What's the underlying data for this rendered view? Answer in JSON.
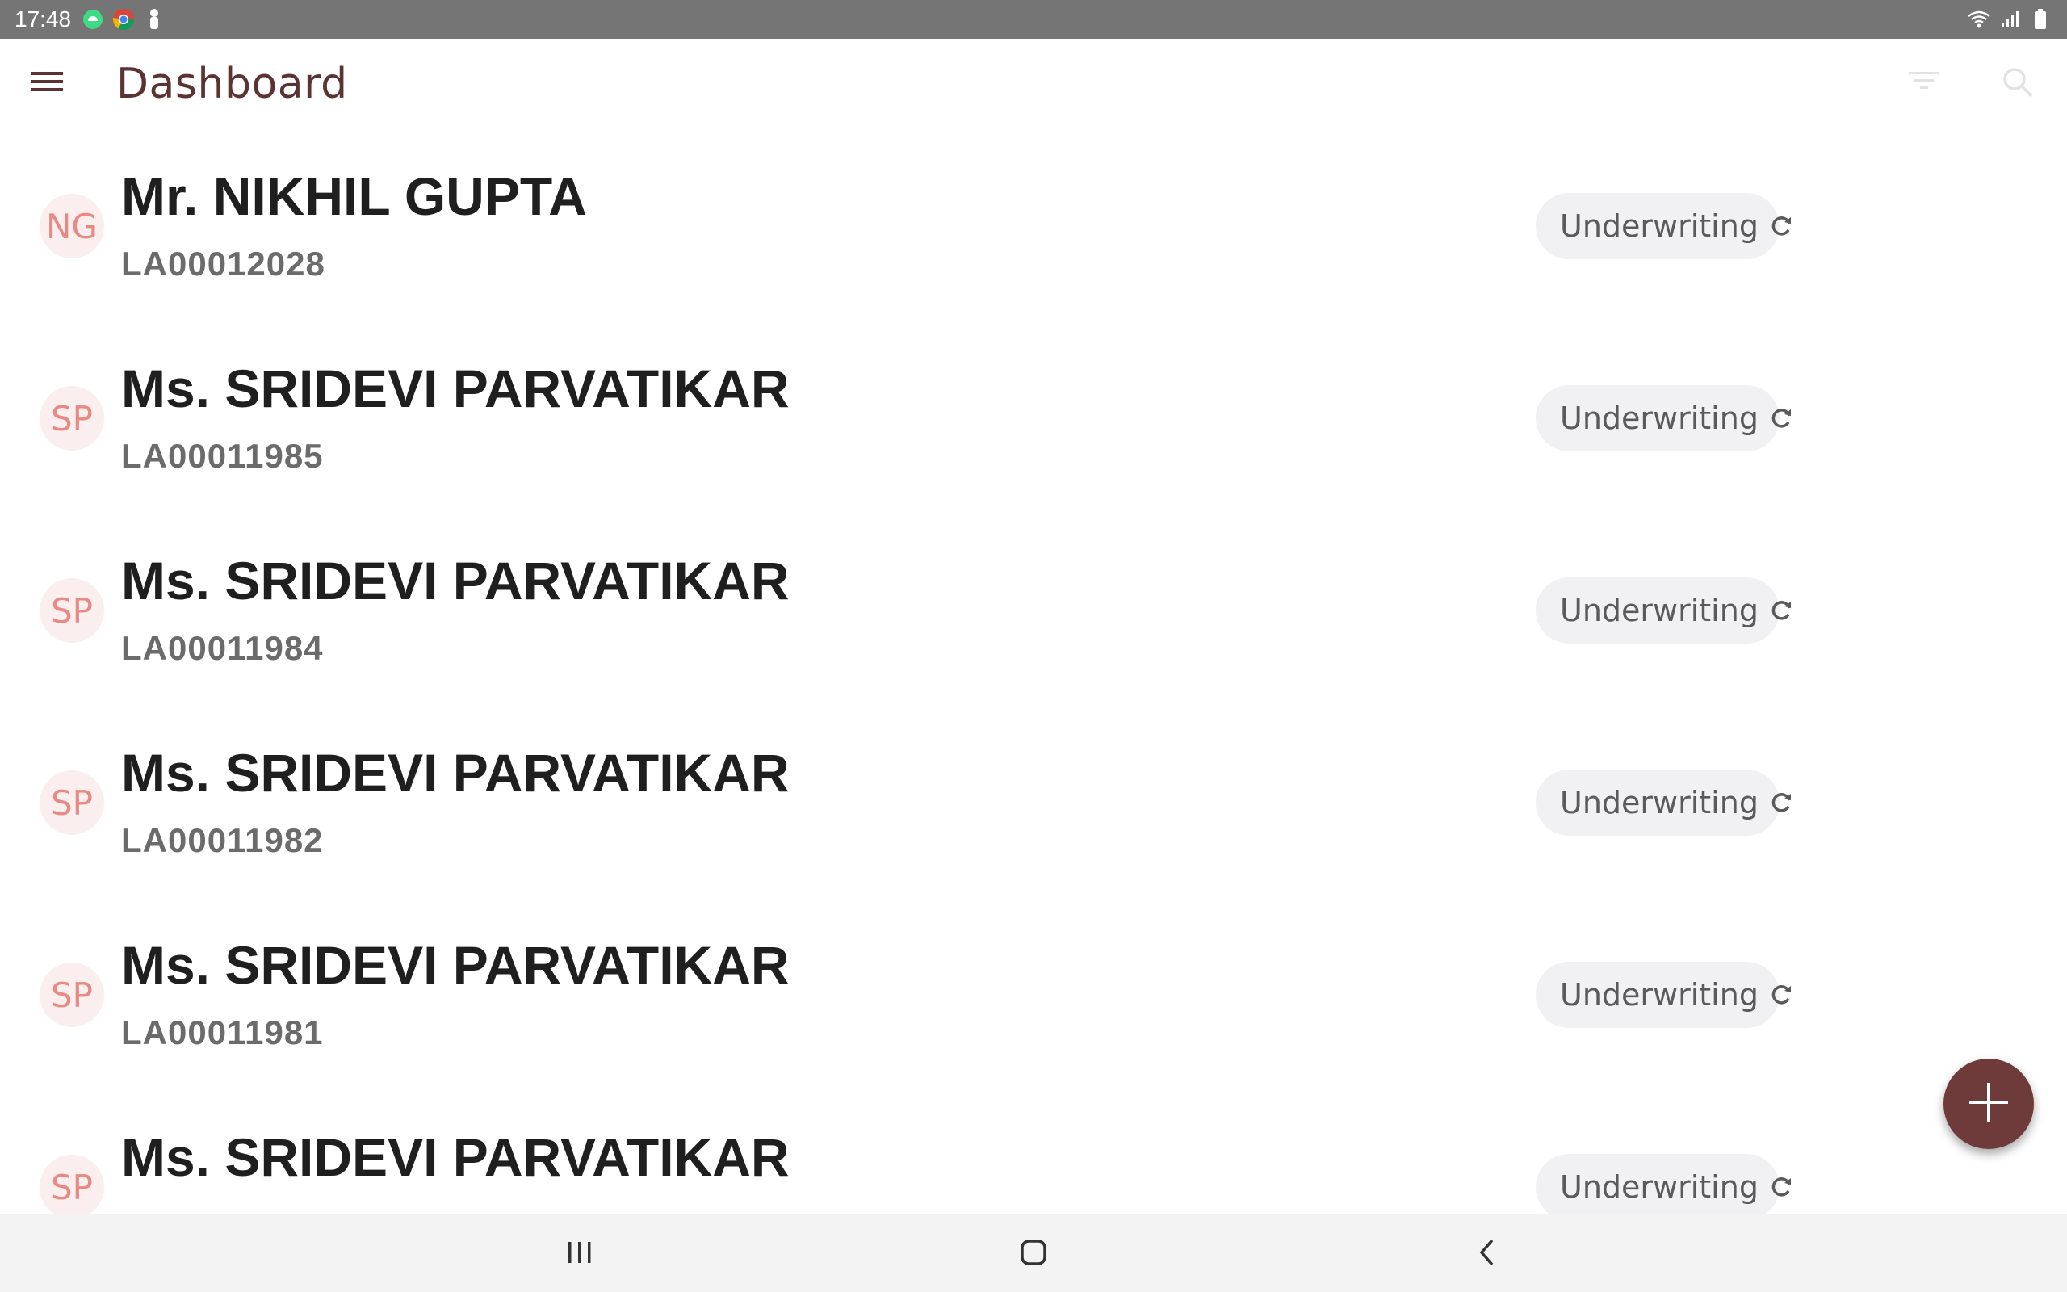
{
  "status_bar": {
    "time": "17:48",
    "left_icons": [
      "android-debug-icon",
      "chrome-icon",
      "person-icon"
    ],
    "right_icons": [
      "wifi-icon",
      "signal-icon",
      "battery-icon"
    ]
  },
  "app_bar": {
    "title": "Dashboard",
    "icons": [
      "menu-icon",
      "filter-icon",
      "search-icon"
    ]
  },
  "list": {
    "items": [
      {
        "initials": "NG",
        "name": "Mr. NIKHIL GUPTA",
        "id": "LA00012028",
        "status": "Underwriting"
      },
      {
        "initials": "SP",
        "name": "Ms. SRIDEVI PARVATIKAR",
        "id": "LA00011985",
        "status": "Underwriting"
      },
      {
        "initials": "SP",
        "name": "Ms. SRIDEVI PARVATIKAR",
        "id": "LA00011984",
        "status": "Underwriting"
      },
      {
        "initials": "SP",
        "name": "Ms. SRIDEVI PARVATIKAR",
        "id": "LA00011982",
        "status": "Underwriting"
      },
      {
        "initials": "SP",
        "name": "Ms. SRIDEVI PARVATIKAR",
        "id": "LA00011981",
        "status": "Underwriting"
      },
      {
        "initials": "SP",
        "name": "Ms. SRIDEVI PARVATIKAR",
        "id": "",
        "status": "Underwriting"
      }
    ],
    "status_icon": "refresh-icon"
  },
  "fab": {
    "icon": "plus-icon"
  },
  "nav_bar": {
    "icons": [
      "recent-apps-icon",
      "home-icon",
      "back-icon"
    ]
  },
  "colors": {
    "status_bar": "#757575",
    "title": "#5b3333",
    "avatar_bg": "#fbeeee",
    "avatar_text": "#e88a83",
    "chip_bg": "#f1f0f3",
    "fab": "#6e3a3a"
  }
}
